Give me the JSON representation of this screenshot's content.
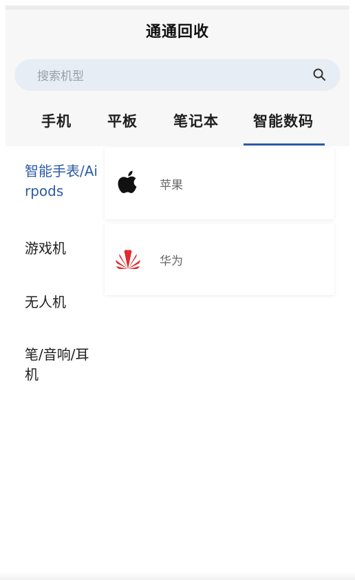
{
  "header": {
    "title": "通通回收"
  },
  "search": {
    "placeholder": "搜索机型",
    "icon": "search-icon"
  },
  "tabs": [
    {
      "label": "手机",
      "active": false
    },
    {
      "label": "平板",
      "active": false
    },
    {
      "label": "笔记本",
      "active": false
    },
    {
      "label": "智能数码",
      "active": true
    }
  ],
  "sidebar": {
    "items": [
      {
        "label": "智能手表/Airpods",
        "active": true
      },
      {
        "label": "游戏机",
        "active": false
      },
      {
        "label": "无人机",
        "active": false
      },
      {
        "label": "笔/音响/耳机",
        "active": false
      }
    ]
  },
  "brands": [
    {
      "name": "苹果",
      "icon": "apple-logo-icon"
    },
    {
      "name": "华为",
      "icon": "huawei-logo-icon"
    }
  ],
  "colors": {
    "accent": "#2d5aa8",
    "huawei_red": "#e12a2f"
  }
}
